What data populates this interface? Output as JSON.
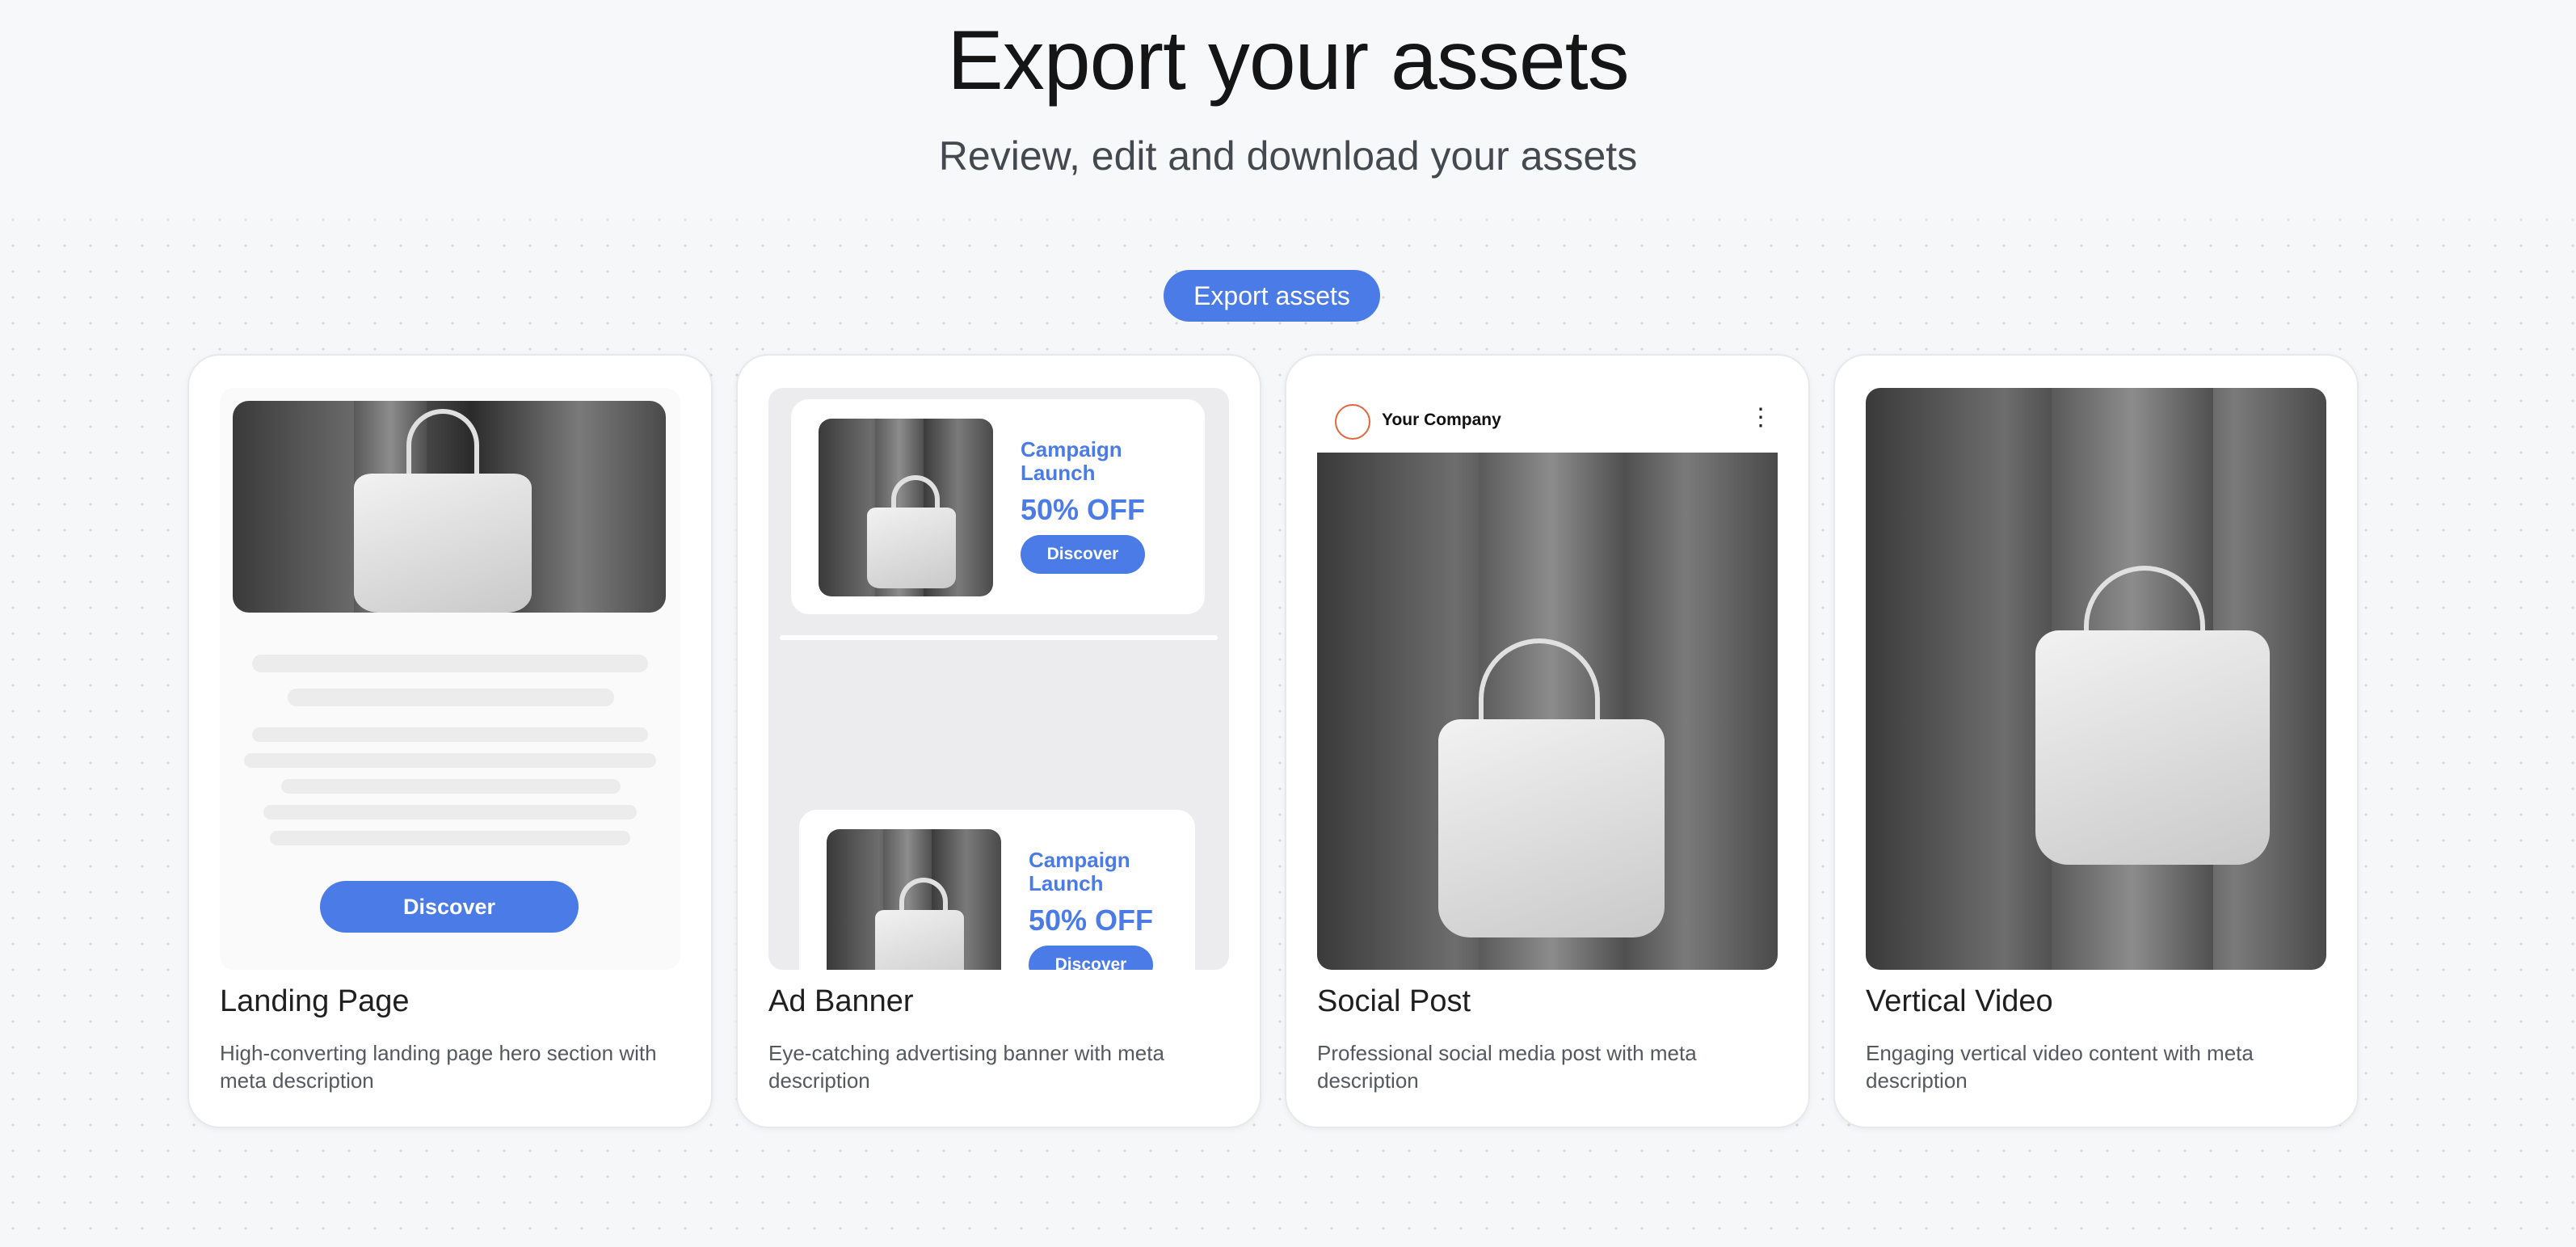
{
  "header": {
    "title": "Export your assets",
    "subtitle": "Review, edit and download your assets"
  },
  "actions": {
    "export_label": "Export assets"
  },
  "colors": {
    "accent": "#4a7be6",
    "background": "#f6f7f9",
    "card": "#ffffff"
  },
  "cards": [
    {
      "title": "Landing Page",
      "description": "High-converting landing page hero section with meta description",
      "preview": {
        "button_label": "Discover"
      }
    },
    {
      "title": "Ad Banner",
      "description": "Eye-catching advertising banner with meta description",
      "preview": {
        "headline": "Campaign Launch",
        "offer": "50% OFF",
        "button_label": "Discover"
      }
    },
    {
      "title": "Social Post",
      "description": "Professional social media post with meta description",
      "preview": {
        "company": "Your Company",
        "menu_icon": "more-vertical-icon"
      }
    },
    {
      "title": "Vertical Video",
      "description": "Engaging vertical video content with meta description"
    }
  ]
}
